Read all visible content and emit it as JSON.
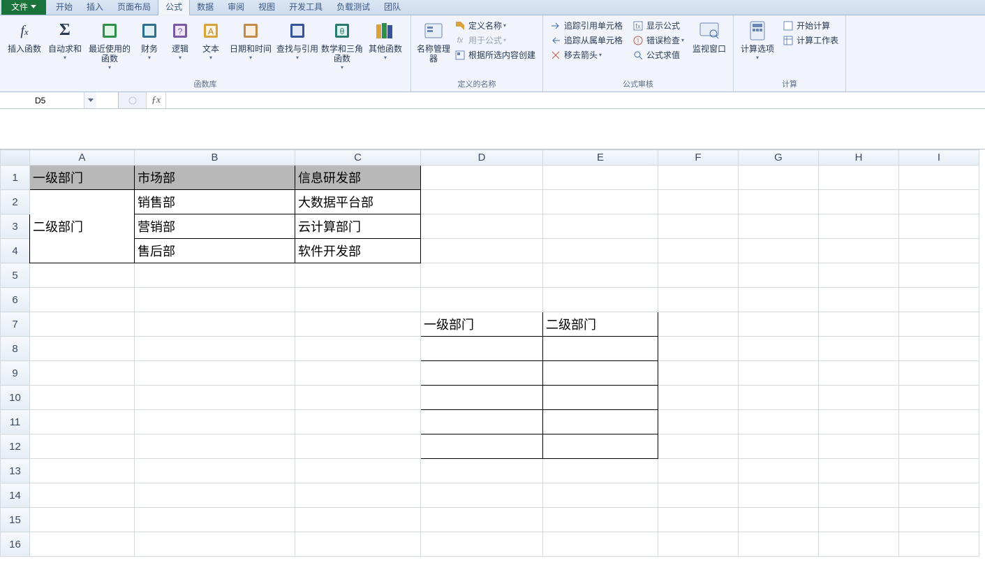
{
  "menu": {
    "file": "文件",
    "tabs": [
      "开始",
      "插入",
      "页面布局",
      "公式",
      "数据",
      "审阅",
      "视图",
      "开发工具",
      "负载测试",
      "团队"
    ],
    "active": 3
  },
  "ribbon": {
    "groups": {
      "funclib": {
        "label": "函数库",
        "insertfn": "插入函数",
        "autosum": "自动求和",
        "recent": "最近使用的函数",
        "financial": "财务",
        "logical": "逻辑",
        "text": "文本",
        "datetime": "日期和时间",
        "lookup": "查找与引用",
        "math": "数学和三角函数",
        "other": "其他函数"
      },
      "names": {
        "label": "定义的名称",
        "manager": "名称管理器",
        "define": "定义名称",
        "useinf": "用于公式",
        "createsel": "根据所选内容创建"
      },
      "audit": {
        "label": "公式审核",
        "traceprec": "追踪引用单元格",
        "tracedep": "追踪从属单元格",
        "removearrows": "移去箭头",
        "showf": "显示公式",
        "errcheck": "错误检查",
        "eval": "公式求值",
        "watch": "监视窗口"
      },
      "calc": {
        "label": "计算",
        "options": "计算选项",
        "calcnow": "开始计算",
        "calcsheet": "计算工作表"
      }
    }
  },
  "namebox": "D5",
  "formula": "",
  "columns": [
    "A",
    "B",
    "C",
    "D",
    "E",
    "F",
    "G",
    "H",
    "I"
  ],
  "rows": [
    "1",
    "2",
    "3",
    "4",
    "5",
    "6",
    "7",
    "8",
    "9",
    "10",
    "11",
    "12",
    "13",
    "14",
    "15",
    "16"
  ],
  "cells": {
    "A1": "一级部门",
    "B1": "市场部",
    "C1": "信息研发部",
    "A2_4": "二级部门",
    "B2": "销售部",
    "C2": "大数据平台部",
    "B3": "营销部",
    "C3": "云计算部门",
    "B4": "售后部",
    "C4": "软件开发部",
    "D7": "一级部门",
    "E7": "二级部门"
  },
  "colwidths": {
    "A": 150,
    "B": 230,
    "C": 180,
    "D": 175,
    "E": 165,
    "F": 115,
    "G": 115,
    "H": 115,
    "I": 115
  }
}
